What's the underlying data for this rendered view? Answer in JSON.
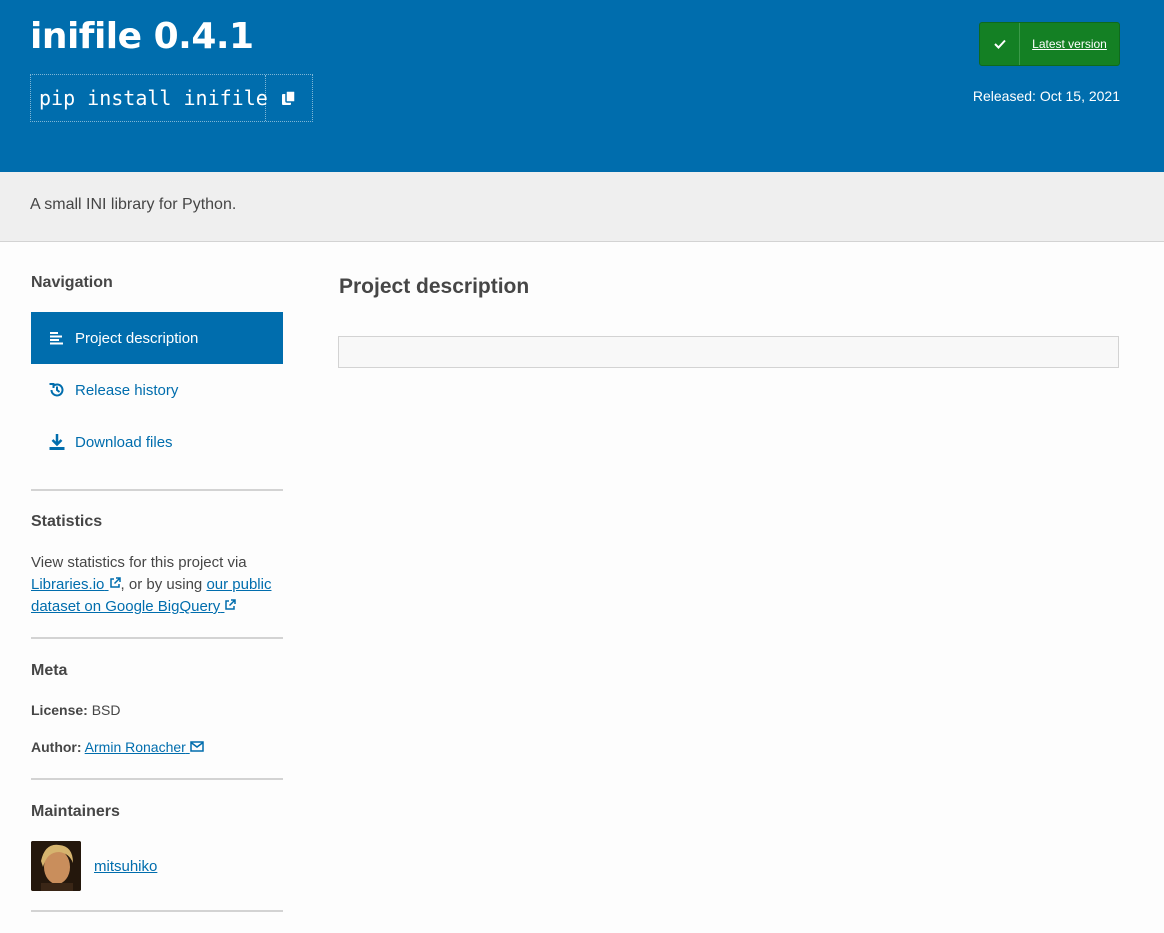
{
  "header": {
    "title": "inifile 0.4.1",
    "pip_command": "pip install inifile",
    "latest_version_label": "Latest version",
    "released": "Released: Oct 15, 2021"
  },
  "summary": "A small INI library for Python.",
  "sidebar": {
    "navigation_heading": "Navigation",
    "nav_items": [
      {
        "label": "Project description",
        "icon": "align-left-icon",
        "active": true
      },
      {
        "label": "Release history",
        "icon": "history-icon",
        "active": false
      },
      {
        "label": "Download files",
        "icon": "download-icon",
        "active": false
      }
    ],
    "statistics_heading": "Statistics",
    "statistics": {
      "prefix": "View statistics for this project via",
      "link1": "Libraries.io",
      "middle": ", or by using",
      "link2": "our public dataset on Google BigQuery"
    },
    "meta_heading": "Meta",
    "meta": {
      "license_label": "License:",
      "license_value": "BSD",
      "author_label": "Author:",
      "author_value": "Armin Ronacher"
    },
    "maintainers_heading": "Maintainers",
    "maintainers": [
      {
        "name": "mitsuhiko"
      }
    ]
  },
  "main": {
    "title": "Project description"
  },
  "colors": {
    "brand_blue": "#006dad",
    "latest_green": "#148024"
  }
}
